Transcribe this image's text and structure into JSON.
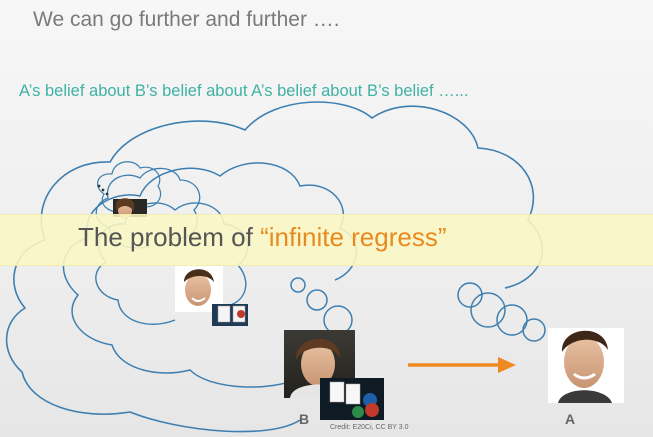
{
  "slide": {
    "heading": "We can go further and further ….",
    "subheading": "A’s belief about B’s belief about A’s belief about B’s belief …...",
    "banner": {
      "prefix": "The problem of ",
      "open_quote": "“",
      "highlight": "infinite regress",
      "close_quote": "”"
    },
    "label_b": "B",
    "label_a": "A",
    "credit": "Credit: E20Ci, CC BY 3.0",
    "ellipsis": "…"
  },
  "colors": {
    "teal_text": "#3fb2a4",
    "orange_accent": "#e88a1f",
    "cloud_stroke": "#3e7fb0",
    "banner_bg": "#faf8c4"
  }
}
